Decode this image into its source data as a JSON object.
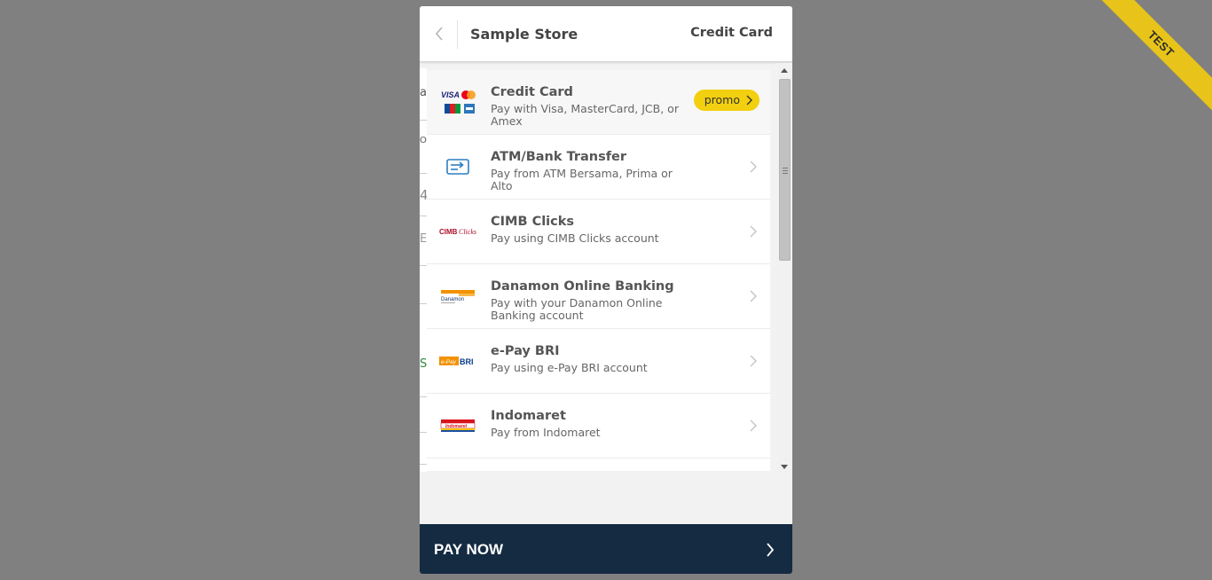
{
  "ribbon": {
    "text": "TEST",
    "color": "#e8c41a"
  },
  "header": {
    "back_icon": "chevron-left-icon",
    "store_name": "Sample Store",
    "page_title": "Credit Card"
  },
  "behind_fragments": [
    "ar",
    "Or",
    "4",
    "E",
    "Sc"
  ],
  "payment_methods": [
    {
      "title": "Credit Card",
      "description": "Pay with Visa, MasterCard, JCB, or Amex",
      "logo": "card-networks-logo",
      "badge": "promo",
      "selected": true
    },
    {
      "title": "ATM/Bank Transfer",
      "description": "Pay from ATM Bersama, Prima or Alto",
      "logo": "bank-transfer-icon"
    },
    {
      "title": "CIMB Clicks",
      "description": "Pay using CIMB Clicks account",
      "logo": "cimb-clicks-logo",
      "logo_text": "CIMB",
      "logo_text_2": "Clicks"
    },
    {
      "title": "Danamon Online Banking",
      "description": "Pay with your Danamon Online Banking account",
      "logo": "danamon-logo",
      "logo_text": "Danamon"
    },
    {
      "title": "e-Pay BRI",
      "description": "Pay using e-Pay BRI account",
      "logo": "epay-bri-logo",
      "logo_text": "e-Pay",
      "logo_text_2": "BRI"
    },
    {
      "title": "Indomaret",
      "description": "Pay from Indomaret",
      "logo": "indomaret-logo",
      "logo_text": "Indomaret"
    }
  ],
  "pay_button": {
    "label": "PAY NOW",
    "color": "#142b42"
  },
  "colors": {
    "background": "#808080",
    "promo": "#f2d00f",
    "accent_blue": "#2d7fc1"
  }
}
